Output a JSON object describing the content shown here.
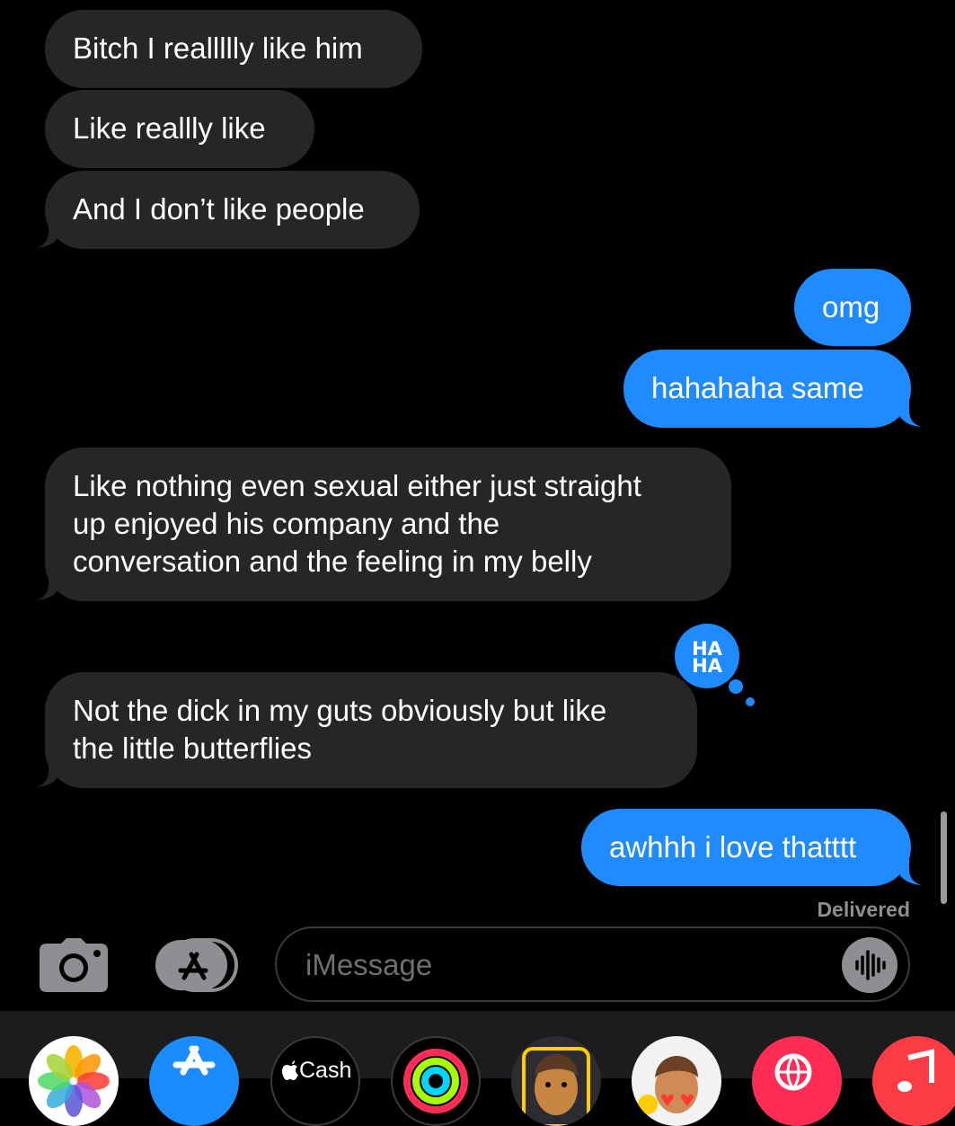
{
  "thread": {
    "messages": [
      {
        "text": "Bitch I reallllly like him",
        "direction": "received"
      },
      {
        "text": "Like reallly like",
        "direction": "received"
      },
      {
        "text": "And I don’t like people",
        "direction": "received"
      },
      {
        "text": "omg",
        "direction": "sent"
      },
      {
        "text": "hahahaha same",
        "direction": "sent"
      },
      {
        "lines": [
          "Like nothing even sexual either just straight",
          "up enjoyed his company and the",
          "conversation and the feeling in my belly"
        ],
        "direction": "received"
      },
      {
        "lines": [
          "Not the dick in my guts obviously but like",
          "the little butterflies"
        ],
        "direction": "received",
        "tapback": "haha"
      },
      {
        "text": "awhhh i love thatttt",
        "direction": "sent"
      }
    ],
    "tapback_label": [
      "HA",
      "HA"
    ],
    "status": "Delivered"
  },
  "compose": {
    "placeholder": "iMessage",
    "camera_icon": "camera-icon",
    "apps_icon": "app-store-icon",
    "audio_icon": "waveform-icon"
  },
  "app_drawer": {
    "items": [
      {
        "icon": "photos-icon"
      },
      {
        "icon": "app-store-icon"
      },
      {
        "icon": "apple-cash-icon",
        "label": "Cash"
      },
      {
        "icon": "activity-rings-icon"
      },
      {
        "icon": "memoji-icon"
      },
      {
        "icon": "memoji-stickers-icon"
      },
      {
        "icon": "search-images-icon"
      },
      {
        "icon": "music-icon"
      }
    ]
  },
  "colors": {
    "background": "#000000",
    "received_bubble": "#262628",
    "sent_bubble": "#1f8bff",
    "placeholder": "#6e6e73",
    "status": "#8e8e93"
  }
}
